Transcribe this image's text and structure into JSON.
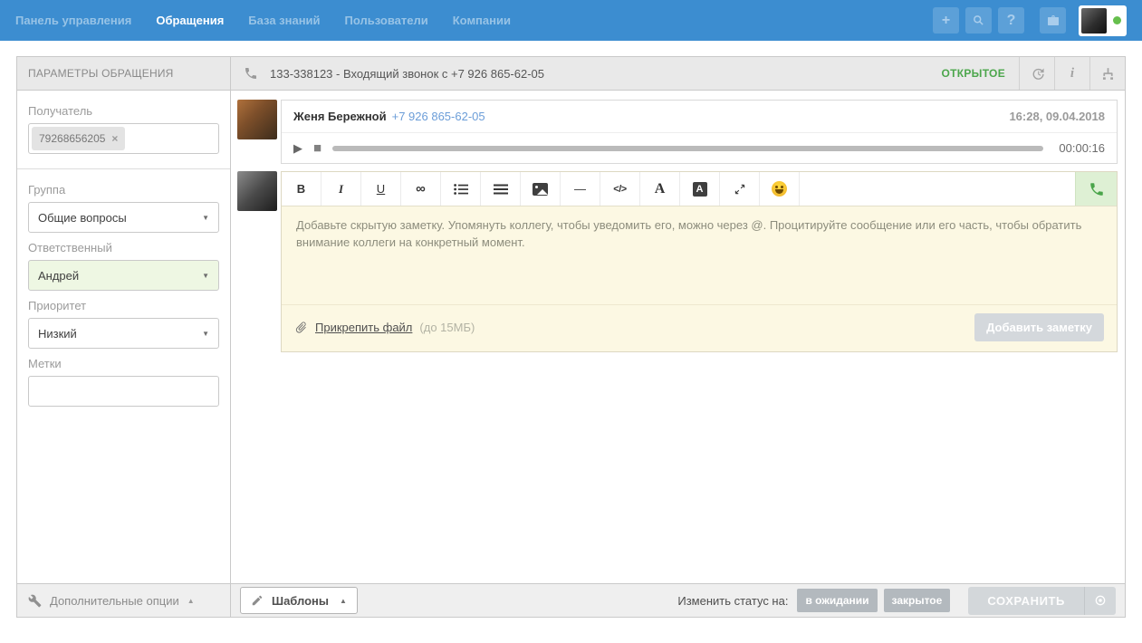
{
  "nav": {
    "items": [
      {
        "label": "Панель управления",
        "active": false
      },
      {
        "label": "Обращения",
        "active": true
      },
      {
        "label": "База знаний",
        "active": false
      },
      {
        "label": "Пользователи",
        "active": false
      },
      {
        "label": "Компании",
        "active": false
      }
    ],
    "add_label": "+",
    "help_label": "?"
  },
  "sidebar": {
    "title": "ПАРАМЕТРЫ ОБРАЩЕНИЯ",
    "recipient_label": "Получатель",
    "recipient_tag": "79268656205",
    "remove_tag_label": "×",
    "fields": [
      {
        "label": "Группа",
        "value": "Общие вопросы"
      },
      {
        "label": "Ответственный",
        "value": "Андрей"
      },
      {
        "label": "Приоритет",
        "value": "Низкий"
      },
      {
        "label": "Метки",
        "value": ""
      }
    ],
    "more_options_label": "Дополнительные опции"
  },
  "ticket": {
    "subject": "133-338123 - Входящий звонок с +7 926 865-62-05",
    "status": "ОТКРЫТОЕ",
    "message": {
      "author": "Женя Бережной",
      "phone": "+7 926 865-62-05",
      "timestamp": "16:28, 09.04.2018",
      "duration": "00:00:16"
    },
    "editor": {
      "toolbar": {
        "bold": "B",
        "italic": "I",
        "underline": "U",
        "link": "∞",
        "hr": "—",
        "code": "</>",
        "font": "A",
        "bg_font": "A"
      },
      "placeholder": "Добавьте скрытую заметку. Упомянуть коллегу, чтобы уведомить его, можно через @. Процитируйте сообщение или его часть, чтобы обратить внимание коллеги на конкретный момент.",
      "attach_label": "Прикрепить файл",
      "attach_hint": "(до 15МБ)",
      "submit_label": "Добавить заметку"
    },
    "footer": {
      "templates_label": "Шаблоны",
      "status_label": "Изменить статус на:",
      "pending_label": "в ожидании",
      "closed_label": "закрытое",
      "save_label": "СОХРАНИТЬ"
    }
  },
  "colors": {
    "nav_bg": "#3c8dd0",
    "status_open_green": "#4ca64c",
    "note_bg": "#fcf8e3",
    "link_blue": "#6b9dd8",
    "responsible_bg": "#eef7e3",
    "online_dot": "#66bf4d"
  }
}
